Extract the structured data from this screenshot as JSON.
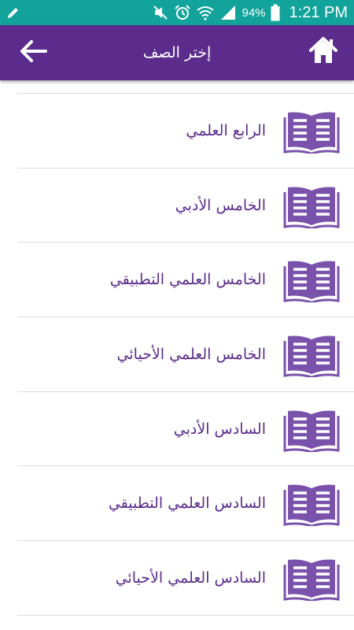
{
  "status_bar": {
    "battery_percent": "94%",
    "time": "1:21 PM",
    "icons": [
      "pencil-icon",
      "mute-icon",
      "alarm-icon",
      "wifi-icon",
      "signal-icon",
      "battery-icon"
    ]
  },
  "app_bar": {
    "title": "إختر الصف",
    "back_icon": "back-arrow-icon",
    "home_icon": "home-icon"
  },
  "grades": [
    {
      "label": "الرابع العلمي",
      "icon": "book-icon"
    },
    {
      "label": "الخامس الأدبي",
      "icon": "book-icon"
    },
    {
      "label": "الخامس العلمي التطبيقي",
      "icon": "book-icon"
    },
    {
      "label": "الخامس العلمي الأحيائي",
      "icon": "book-icon"
    },
    {
      "label": "السادس الأدبي",
      "icon": "book-icon"
    },
    {
      "label": "السادس العلمي التطبيقي",
      "icon": "book-icon"
    },
    {
      "label": "السادس العلمي الأحيائي",
      "icon": "book-icon"
    }
  ],
  "colors": {
    "status_bar": "#12a39a",
    "app_bar": "#5b2c8c",
    "accent": "#7b52ab",
    "divider": "#dcdcdc"
  }
}
